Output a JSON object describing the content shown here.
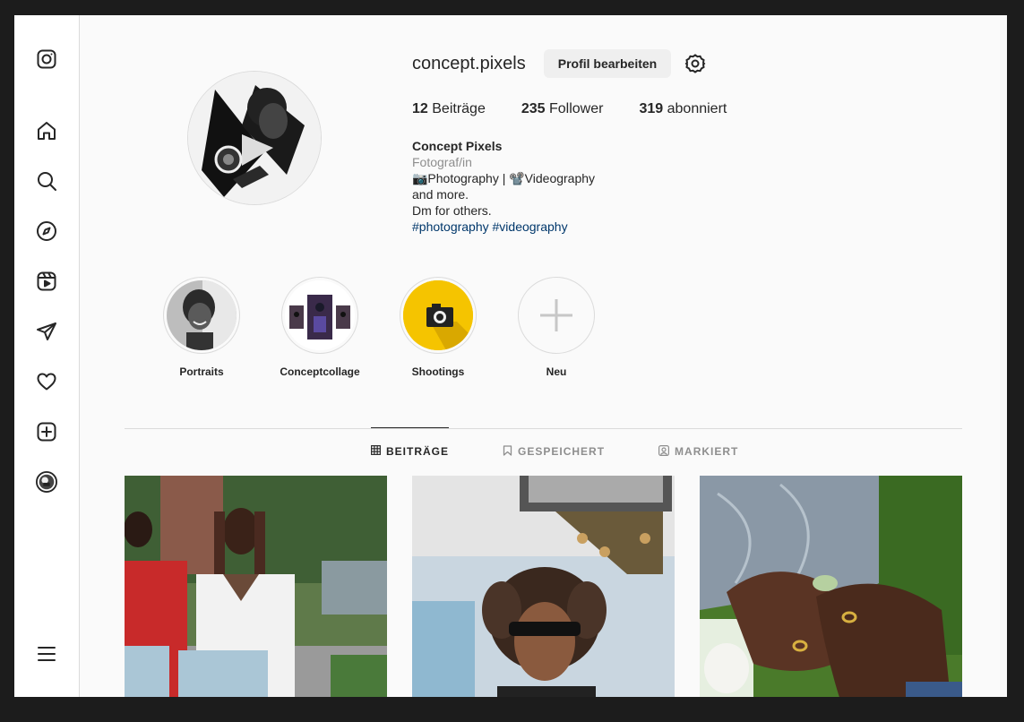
{
  "sidebar": {
    "items": [
      {
        "icon": "instagram-logo-icon"
      },
      {
        "icon": "home-icon"
      },
      {
        "icon": "search-icon"
      },
      {
        "icon": "explore-compass-icon"
      },
      {
        "icon": "reels-icon"
      },
      {
        "icon": "direct-messages-icon"
      },
      {
        "icon": "notifications-heart-icon"
      },
      {
        "icon": "create-plus-icon"
      },
      {
        "icon": "profile-avatar-icon"
      },
      {
        "icon": "more-menu-icon"
      }
    ]
  },
  "profile": {
    "username": "concept.pixels",
    "edit_label": "Profil bearbeiten",
    "posts_count": "12",
    "posts_label": "Beiträge",
    "followers_count": "235",
    "followers_label": "Follower",
    "following_count": "319",
    "following_label": "abonniert",
    "display_name": "Concept Pixels",
    "category": "Fotograf/in",
    "bio_line1": "📷Photography |  📽️Videography",
    "bio_line2": "and more.",
    "bio_line3": "Dm for others.",
    "hashtags": "#photography #videography"
  },
  "highlights": [
    {
      "label": "Portraits"
    },
    {
      "label": "Conceptcollage"
    },
    {
      "label": "Shootings"
    },
    {
      "label": "Neu"
    }
  ],
  "tabs": [
    {
      "label": "BEITRÄGE",
      "icon": "grid-icon",
      "active": true
    },
    {
      "label": "GESPEICHERT",
      "icon": "bookmark-icon",
      "active": false
    },
    {
      "label": "MARKIERT",
      "icon": "tagged-person-icon",
      "active": false
    }
  ],
  "colors": {
    "accent_text": "#262626",
    "secondary_text": "#8e8e8e",
    "hashtag": "#00376b",
    "highlight_yellow": "#f5c400"
  }
}
